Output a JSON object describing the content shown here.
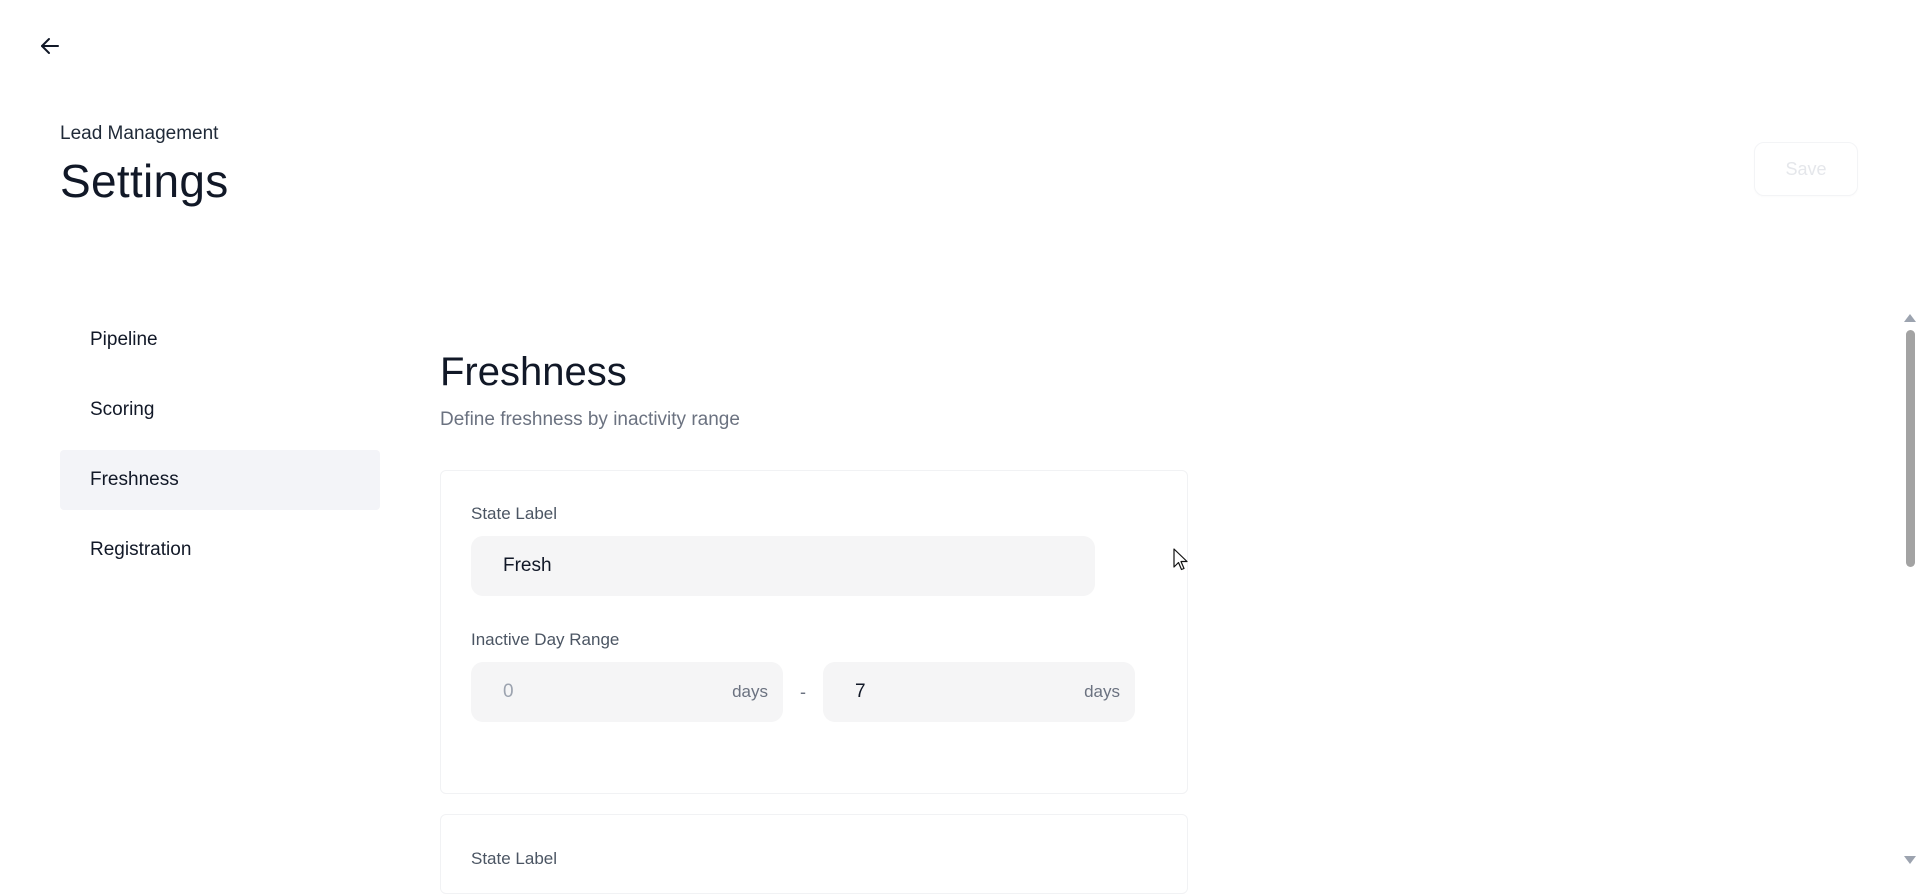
{
  "header": {
    "breadcrumb": "Lead Management",
    "title": "Settings",
    "save_label": "Save",
    "back_icon": "arrow-left-icon"
  },
  "sidebar": {
    "items": [
      {
        "label": "Pipeline",
        "active": false
      },
      {
        "label": "Scoring",
        "active": false
      },
      {
        "label": "Freshness",
        "active": true
      },
      {
        "label": "Registration",
        "active": false
      }
    ]
  },
  "main": {
    "title": "Freshness",
    "subtitle": "Define freshness by inactivity range",
    "cards": [
      {
        "state_label": "State Label",
        "state_value": "Fresh",
        "range_label": "Inactive Day Range",
        "range_from": "0",
        "range_to": "7",
        "unit": "days",
        "separator": "-"
      },
      {
        "state_label": "State Label"
      }
    ]
  },
  "colors": {
    "active_sidebar_bg": "#f3f4f8",
    "input_bg": "#f5f5f6",
    "muted_text": "#6b7280"
  }
}
